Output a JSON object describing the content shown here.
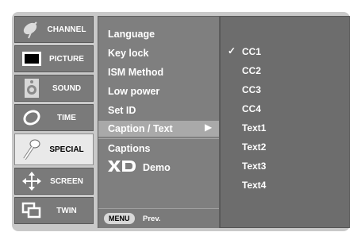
{
  "tabs": [
    {
      "label": "CHANNEL",
      "icon": "satellite-dish-icon"
    },
    {
      "label": "PICTURE",
      "icon": "tv-screen-icon"
    },
    {
      "label": "SOUND",
      "icon": "speaker-icon"
    },
    {
      "label": "TIME",
      "icon": "clock-icon"
    },
    {
      "label": "SPECIAL",
      "icon": "key-icon",
      "active": true
    },
    {
      "label": "SCREEN",
      "icon": "move-arrows-icon"
    },
    {
      "label": "TWIN",
      "icon": "twin-screen-icon"
    }
  ],
  "menu": {
    "items": [
      "Language",
      "Key lock",
      "ISM Method",
      "Low power",
      "Set ID",
      "Caption / Text",
      "Captions",
      "Demo"
    ],
    "selected": "Caption / Text",
    "xd_logo": "XD",
    "footer_button": "MENU",
    "footer_text": "Prev."
  },
  "submenu": {
    "items": [
      "CC1",
      "CC2",
      "CC3",
      "CC4",
      "Text1",
      "Text2",
      "Text3",
      "Text4"
    ],
    "checked": "CC1",
    "check_mark": "✓"
  }
}
